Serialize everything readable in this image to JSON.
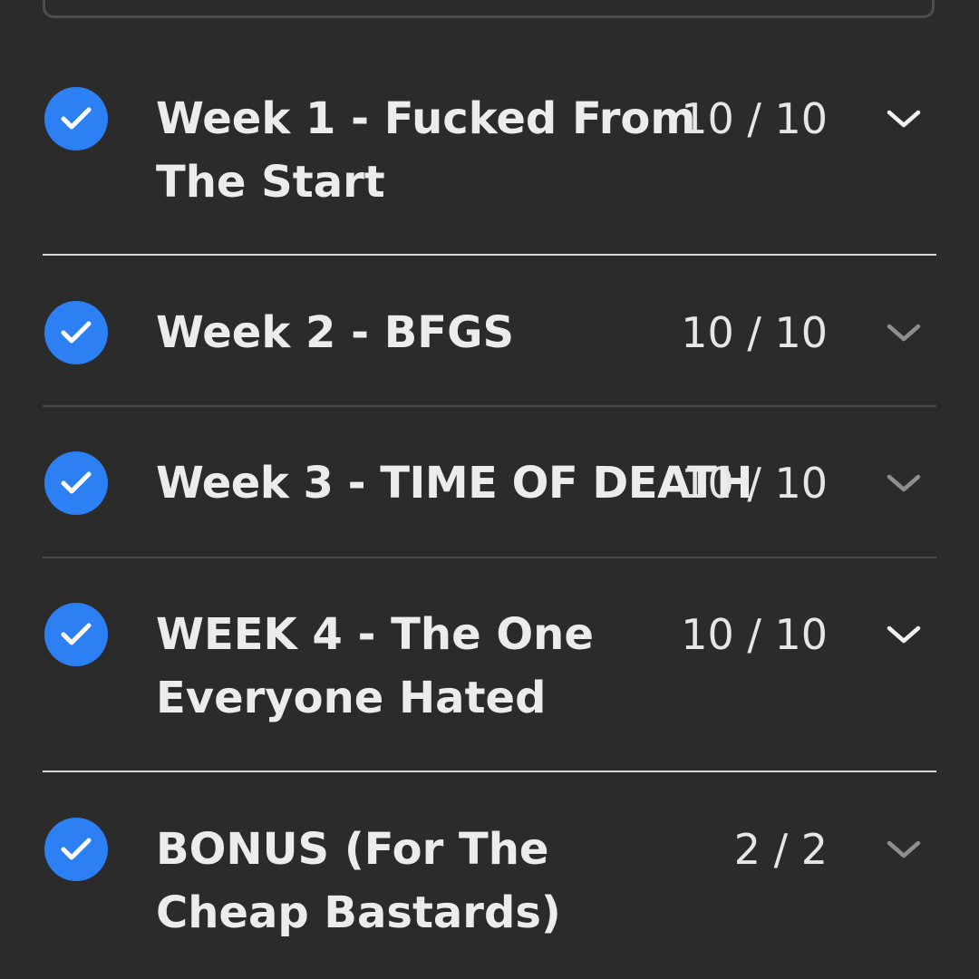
{
  "colors": {
    "background": "#2b2b2b",
    "check_blue": "#2d7ff4",
    "text": "#ececec",
    "chevron_open": "#f2f2f2",
    "chevron_closed": "#8e8e8e"
  },
  "sections": [
    {
      "title": "Week 1 - Fucked From The Start",
      "count": "10 / 10",
      "completed": true,
      "expanded": true
    },
    {
      "title": "Week 2 - BFGS",
      "count": "10 / 10",
      "completed": true,
      "expanded": false
    },
    {
      "title": "Week 3 - TIME OF DEATH",
      "count": "10 / 10",
      "completed": true,
      "expanded": false
    },
    {
      "title": "WEEK 4 - The One Everyone Hated",
      "count": "10 / 10",
      "completed": true,
      "expanded": true
    },
    {
      "title": "BONUS (For The Cheap Bastards)",
      "count": "2 / 2",
      "completed": true,
      "expanded": false
    }
  ],
  "icons": {
    "check": "checkmark-circle-icon",
    "chevron": "chevron-down-icon"
  }
}
